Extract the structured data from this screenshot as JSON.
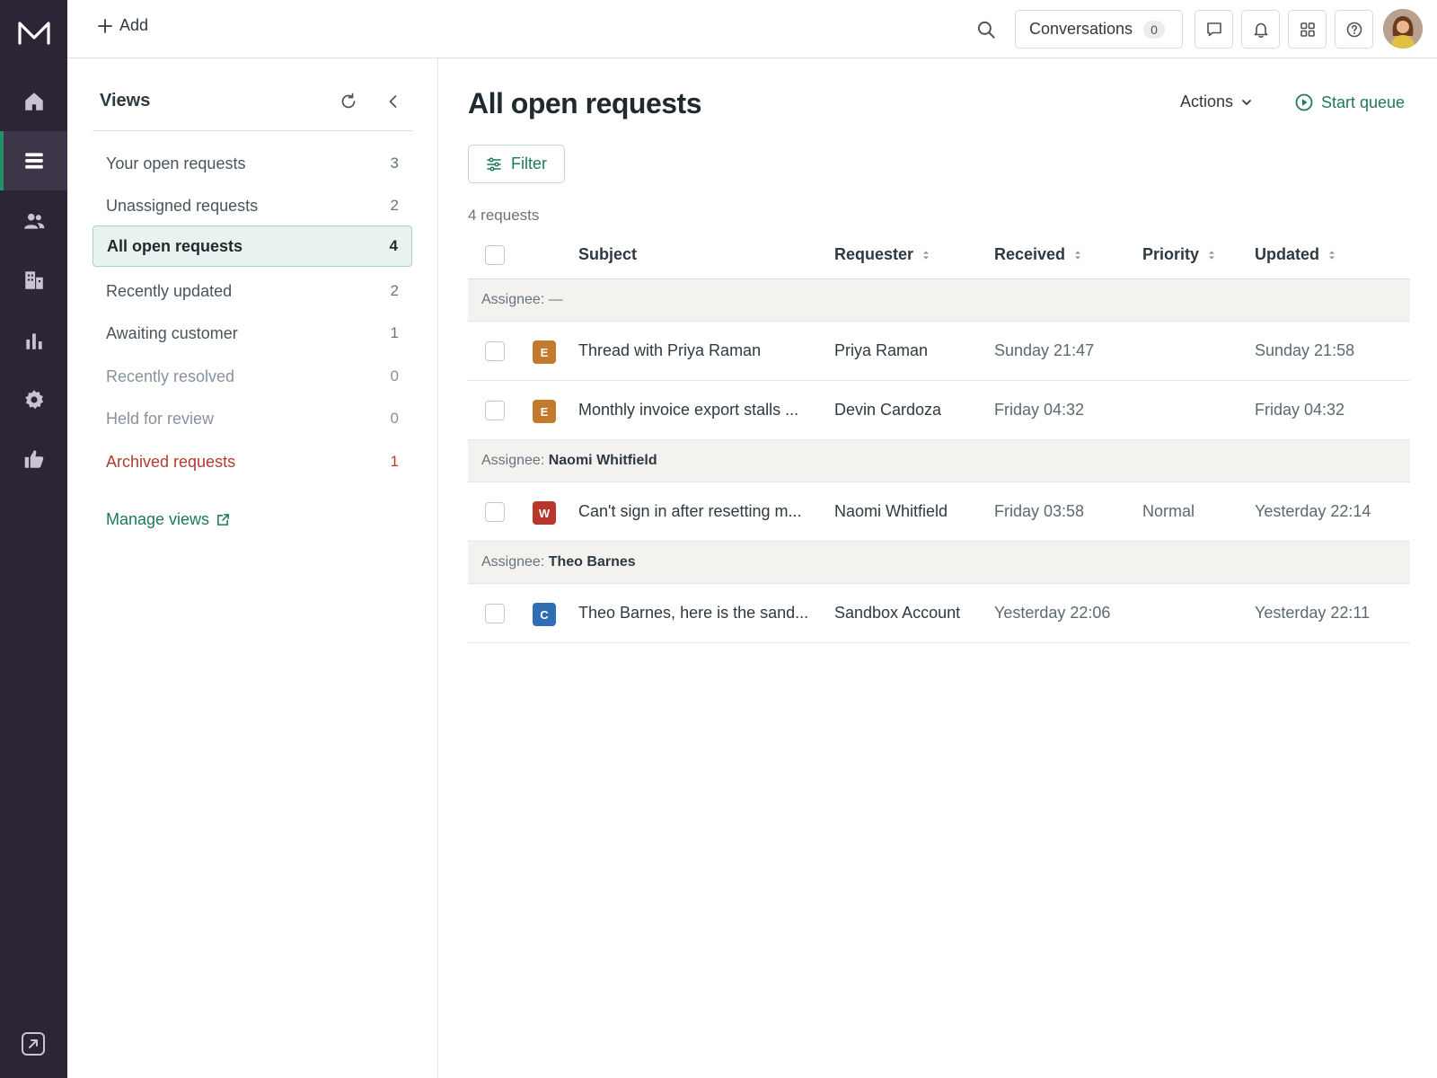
{
  "topbar": {
    "add_label": "Add",
    "conversations_label": "Conversations",
    "conversations_count": "0"
  },
  "views": {
    "title": "Views",
    "items": [
      {
        "label": "Your open requests",
        "count": "3"
      },
      {
        "label": "Unassigned requests",
        "count": "2"
      },
      {
        "label": "All open requests",
        "count": "4"
      },
      {
        "label": "Recently updated",
        "count": "2"
      },
      {
        "label": "Awaiting customer",
        "count": "1"
      },
      {
        "label": "Recently resolved",
        "count": "0"
      },
      {
        "label": "Held for review",
        "count": "0"
      },
      {
        "label": "Archived requests",
        "count": "1"
      }
    ],
    "manage_label": "Manage views"
  },
  "main": {
    "title": "All open requests",
    "actions_label": "Actions",
    "start_queue_label": "Start queue",
    "filter_label": "Filter",
    "request_count": "4 requests",
    "columns": {
      "subject": "Subject",
      "requester": "Requester",
      "received": "Received",
      "priority": "Priority",
      "updated": "Updated"
    },
    "groups": [
      {
        "label": "Assignee:",
        "name": "—",
        "rows": [
          {
            "badge": "E",
            "badge_color": "#c47a2c",
            "subject": "Thread with Priya Raman",
            "requester": "Priya Raman",
            "received": "Sunday 21:47",
            "priority": "",
            "updated": "Sunday 21:58"
          },
          {
            "badge": "E",
            "badge_color": "#c47a2c",
            "subject": "Monthly invoice export stalls ...",
            "requester": "Devin Cardoza",
            "received": "Friday 04:32",
            "priority": "",
            "updated": "Friday 04:32"
          }
        ]
      },
      {
        "label": "Assignee:",
        "name": "Naomi Whitfield",
        "rows": [
          {
            "badge": "W",
            "badge_color": "#b8362c",
            "subject": "Can't sign in after resetting m...",
            "requester": "Naomi Whitfield",
            "received": "Friday 03:58",
            "priority": "Normal",
            "updated": "Yesterday 22:14"
          }
        ]
      },
      {
        "label": "Assignee:",
        "name": "Theo Barnes",
        "rows": [
          {
            "badge": "C",
            "badge_color": "#2f6db5",
            "subject": "Theo Barnes, here is the sand...",
            "requester": "Sandbox Account",
            "received": "Yesterday 22:06",
            "priority": "",
            "updated": "Yesterday 22:11"
          }
        ]
      }
    ]
  }
}
